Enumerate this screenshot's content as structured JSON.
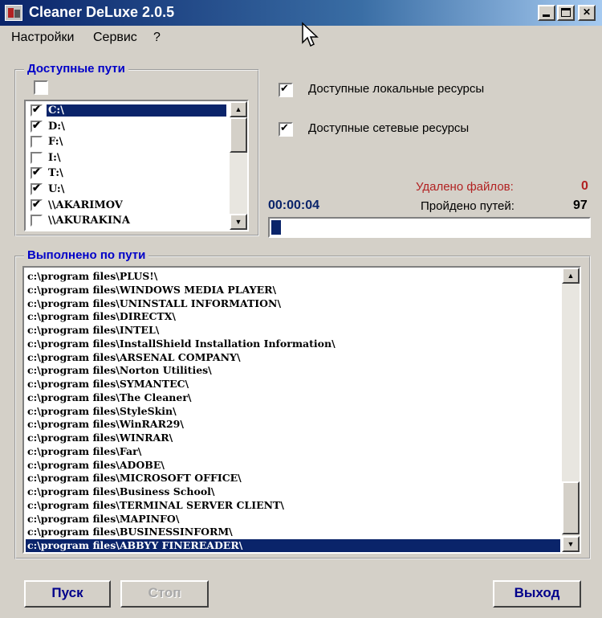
{
  "window": {
    "title": "Cleaner DeLuxe 2.0.5"
  },
  "menu": [
    "Настройки",
    "Сервис",
    "?"
  ],
  "paths_group": {
    "legend": "Доступные пути",
    "drives": [
      {
        "label": "C:\\",
        "checked": true,
        "selected": true
      },
      {
        "label": "D:\\",
        "checked": true
      },
      {
        "label": "F:\\",
        "checked": false
      },
      {
        "label": "I:\\",
        "checked": false
      },
      {
        "label": "T:\\",
        "checked": true
      },
      {
        "label": "U:\\",
        "checked": true
      },
      {
        "label": "\\\\AKARIMOV",
        "checked": true
      },
      {
        "label": "\\\\AKURAKINA",
        "checked": false
      }
    ]
  },
  "options": {
    "local": {
      "label": "Доступные локальные ресурсы",
      "checked": true
    },
    "network": {
      "label": "Доступные сетевые ресурсы",
      "checked": true
    }
  },
  "stats": {
    "deleted_label": "Удалено файлов:",
    "deleted_value": "0",
    "timer": "00:00:04",
    "paths_label": "Пройдено путей:",
    "paths_value": "97",
    "progress": 0.03
  },
  "log_group": {
    "legend": "Выполнено по пути",
    "lines": [
      "c:\\program files\\PLUS!\\",
      "c:\\program files\\WINDOWS MEDIA PLAYER\\",
      "c:\\program files\\UNINSTALL INFORMATION\\",
      "c:\\program files\\DIRECTX\\",
      "c:\\program files\\INTEL\\",
      "c:\\program files\\InstallShield Installation Information\\",
      "c:\\program files\\ARSENAL COMPANY\\",
      "c:\\program files\\Norton Utilities\\",
      "c:\\program files\\SYMANTEC\\",
      "c:\\program files\\The Cleaner\\",
      "c:\\program files\\StyleSkin\\",
      "c:\\program files\\WinRAR29\\",
      "c:\\program files\\WINRAR\\",
      "c:\\program files\\Far\\",
      "c:\\program files\\ADOBE\\",
      "c:\\program files\\MICROSOFT OFFICE\\",
      "c:\\program files\\Business School\\",
      "c:\\program files\\TERMINAL SERVER CLIENT\\",
      "c:\\program files\\MAPINFO\\",
      "c:\\program files\\BUSINESSINFORM\\",
      "c:\\program files\\ABBYY FINEREADER\\"
    ]
  },
  "buttons": {
    "start": "Пуск",
    "stop": "Стоп",
    "exit": "Выход"
  },
  "colors": {
    "accent": "#0a246a",
    "legend": "#0000c8",
    "alert": "#b22222"
  }
}
